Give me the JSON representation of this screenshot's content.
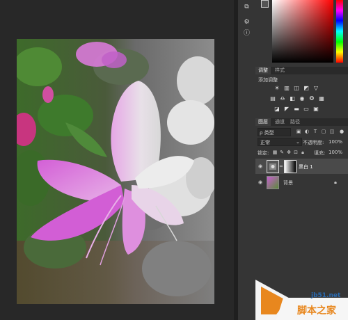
{
  "adjustments_panel": {
    "tabs": [
      "调整",
      "样式"
    ],
    "add_label": "添加调整",
    "icons_row1": [
      "brightness-icon",
      "levels-icon",
      "curves-icon",
      "exposure-icon",
      "vibrance-icon"
    ],
    "icons_row2": [
      "hue-saturation-icon",
      "color-balance-icon",
      "black-white-icon",
      "photo-filter-icon",
      "channel-mixer-icon",
      "color-lookup-icon"
    ],
    "icons_row3": [
      "invert-icon",
      "posterize-icon",
      "threshold-icon",
      "gradient-map-icon",
      "selective-color-icon"
    ]
  },
  "layers_panel": {
    "tabs": [
      "图层",
      "通道",
      "路径"
    ],
    "filter_label": "ρ 类型",
    "blend_mode": "正常",
    "opacity_label": "不透明度:",
    "opacity_value": "100%",
    "lock_label": "锁定:",
    "fill_label": "填充:",
    "fill_value": "100%",
    "layers": [
      {
        "name": "黑白 1",
        "visible": true,
        "selected": true
      },
      {
        "name": "背景",
        "visible": true,
        "selected": false,
        "locked": true
      }
    ]
  },
  "watermark": {
    "site": "jb51.net",
    "brand": "脚本之家"
  },
  "colors": {
    "panel_bg": "#353535",
    "canvas_bg": "#282828",
    "selected_layer": "#4a4a4a",
    "watermark_orange": "#e8871e"
  }
}
